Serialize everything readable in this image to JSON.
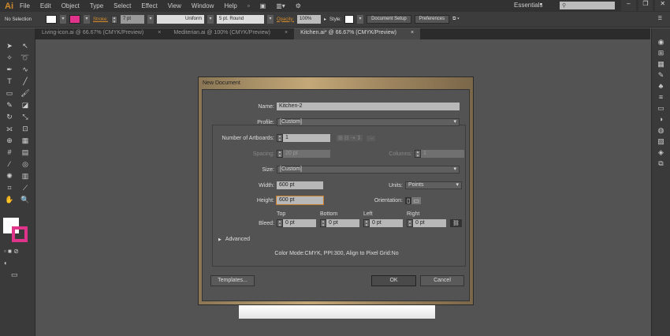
{
  "menubar": {
    "logo": "Ai",
    "items": [
      "File",
      "Edit",
      "Object",
      "Type",
      "Select",
      "Effect",
      "View",
      "Window",
      "Help"
    ],
    "workspace": "Essentials"
  },
  "control": {
    "selection": "No Selection",
    "stroke_label": "Stroke:",
    "stroke_value": "7 pt",
    "profile": "Uniform",
    "brush": "5 pt. Round",
    "opacity_label": "Opacity:",
    "opacity_value": "100%",
    "style_label": "Style:",
    "doc_setup": "Document Setup",
    "preferences": "Preferences"
  },
  "tabs": [
    {
      "label": "Living-icon.ai @ 66.67% (CMYK/Preview)",
      "close": "×"
    },
    {
      "label": "Mediterian.ai @ 100% (CMYK/Preview)",
      "close": "×"
    },
    {
      "label": "Kitchen.ai* @ 66.67% (CMYK/Preview)",
      "close": "×"
    }
  ],
  "dialog": {
    "title": "New Document",
    "name_label": "Name:",
    "name_value": "Kitchen-2",
    "profile_label": "Profile:",
    "profile_value": "[Custom]",
    "artboards_label": "Number of Artboards:",
    "artboards_value": "1",
    "spacing_label": "Spacing:",
    "spacing_value": "20 pt",
    "columns_label": "Columns:",
    "columns_value": "1",
    "size_label": "Size:",
    "size_value": "[Custom]",
    "width_label": "Width:",
    "width_value": "600 pt",
    "units_label": "Units:",
    "units_value": "Points",
    "height_label": "Height:",
    "height_value": "600 pt",
    "orientation_label": "Orientation:",
    "bleed_label": "Bleed:",
    "bleed": [
      {
        "label": "Top",
        "value": "0 pt"
      },
      {
        "label": "Bottom",
        "value": "0 pt"
      },
      {
        "label": "Left",
        "value": "0 pt"
      },
      {
        "label": "Right",
        "value": "0 pt"
      }
    ],
    "advanced_label": "Advanced",
    "info": "Color Mode:CMYK, PPI:300, Align to Pixel Grid:No",
    "templates_button": "Templates...",
    "ok_button": "OK",
    "cancel_button": "Cancel"
  }
}
